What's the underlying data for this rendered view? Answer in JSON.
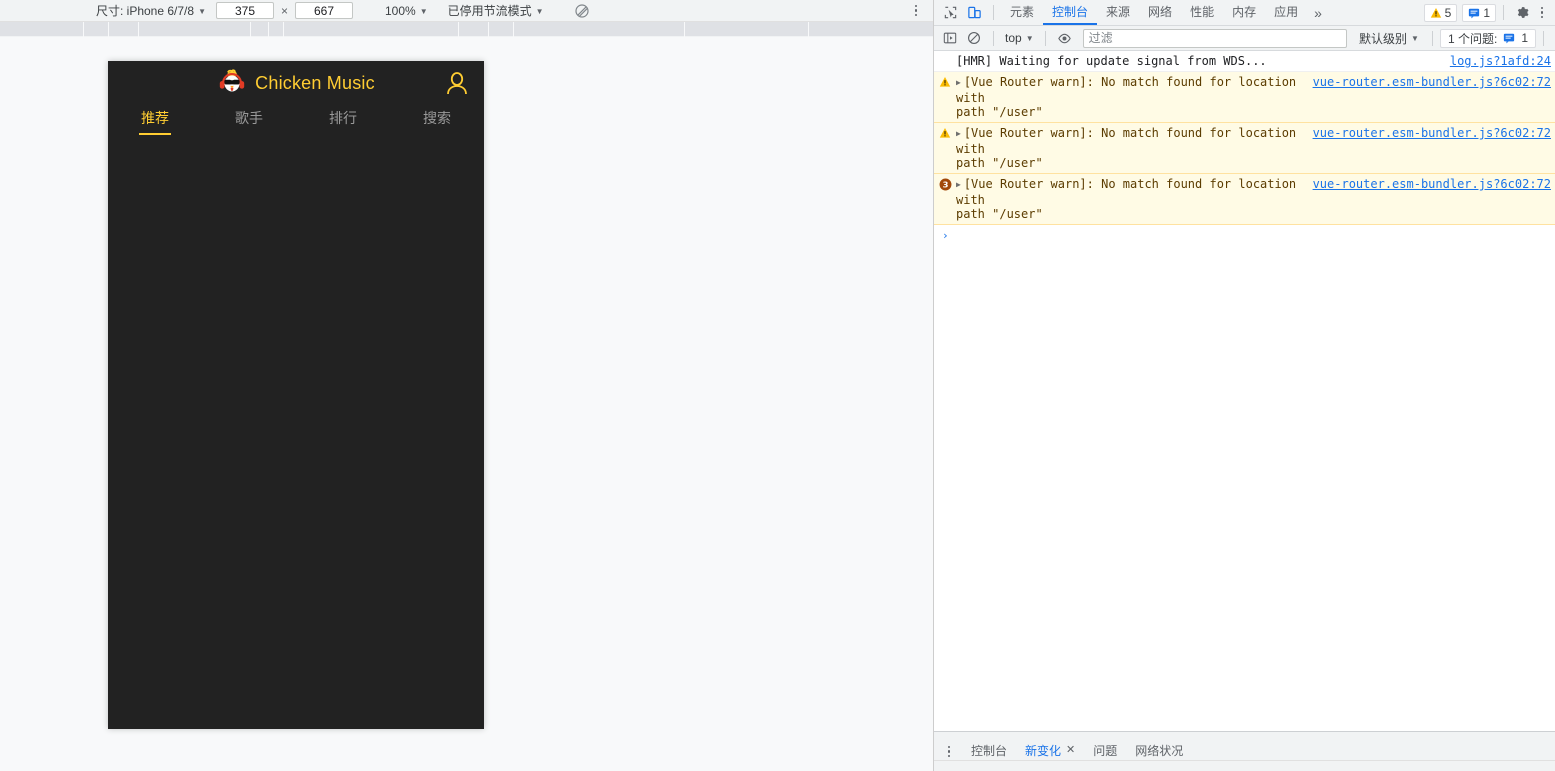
{
  "device_toolbar": {
    "size_label": "尺寸: iPhone 6/7/8",
    "width_value": "375",
    "separator": "×",
    "height_value": "667",
    "zoom_label": "100%",
    "throttle_label": "已停用节流模式",
    "throttle_icon": "no-throttling-icon",
    "kebab_icon": "more-options-icon"
  },
  "phone_app": {
    "brand_title": "Chicken Music",
    "logo_icon": "chicken-logo-icon",
    "user_icon": "user-account-icon",
    "accent_color": "#ffcd32",
    "background_color": "#222222",
    "inactive_color": "#9a9a9a",
    "tabs": [
      {
        "label": "推荐",
        "active": true
      },
      {
        "label": "歌手",
        "active": false
      },
      {
        "label": "排行",
        "active": false
      },
      {
        "label": "搜索",
        "active": false
      }
    ]
  },
  "devtools": {
    "inspect_icon": "inspect-element-icon",
    "device_toggle_icon": "toggle-device-toolbar-icon",
    "panels": [
      {
        "label": "元素",
        "active": false
      },
      {
        "label": "控制台",
        "active": true
      },
      {
        "label": "来源",
        "active": false
      },
      {
        "label": "网络",
        "active": false
      },
      {
        "label": "性能",
        "active": false
      },
      {
        "label": "内存",
        "active": false
      },
      {
        "label": "应用",
        "active": false
      }
    ],
    "more_panels_label": "»",
    "warning_badge": {
      "icon": "warning-triangle-icon",
      "count": "5",
      "color": "#fbbc04"
    },
    "message_badge": {
      "icon": "message-icon",
      "count": "1",
      "color": "#1a73e8"
    },
    "settings_icon": "gear-icon",
    "main_menu_icon": "more-options-icon"
  },
  "console_toolbar": {
    "sidebar_icon": "console-sidebar-icon",
    "clear_icon": "clear-console-icon",
    "context_label": "top",
    "eye_icon": "live-expression-icon",
    "filter_placeholder": "过滤",
    "filter_value": "",
    "level_label": "默认级别",
    "issues_label": "1 个问题:",
    "issues_icon": "message-icon",
    "issues_count": "1"
  },
  "console_messages": [
    {
      "level": "info",
      "icon": null,
      "expandable": false,
      "text": "[HMR] Waiting for update signal from WDS...",
      "source": "log.js?1afd:24"
    },
    {
      "level": "warn",
      "icon": "warning-triangle-icon",
      "expandable": true,
      "text": "[Vue Router warn]: No match found for location with\npath \"/user\"",
      "source": "vue-router.esm-bundler.js?6c02:72"
    },
    {
      "level": "warn",
      "icon": "warning-triangle-icon",
      "expandable": true,
      "text": "[Vue Router warn]: No match found for location with\npath \"/user\"",
      "source": "vue-router.esm-bundler.js?6c02:72"
    },
    {
      "level": "warn",
      "icon": "count-badge",
      "count": "3",
      "expandable": true,
      "text": "[Vue Router warn]: No match found for location with\npath \"/user\"",
      "source": "vue-router.esm-bundler.js?6c02:72"
    }
  ],
  "console_prompt": {
    "caret": "›",
    "value": ""
  },
  "drawer": {
    "kebab_icon": "more-tools-icon",
    "tabs": [
      {
        "label": "控制台",
        "active": false,
        "closable": false
      },
      {
        "label": "新变化",
        "active": true,
        "closable": true,
        "close_icon": "close-icon"
      },
      {
        "label": "问题",
        "active": false,
        "closable": false
      },
      {
        "label": "网络状况",
        "active": false,
        "closable": false
      }
    ]
  }
}
